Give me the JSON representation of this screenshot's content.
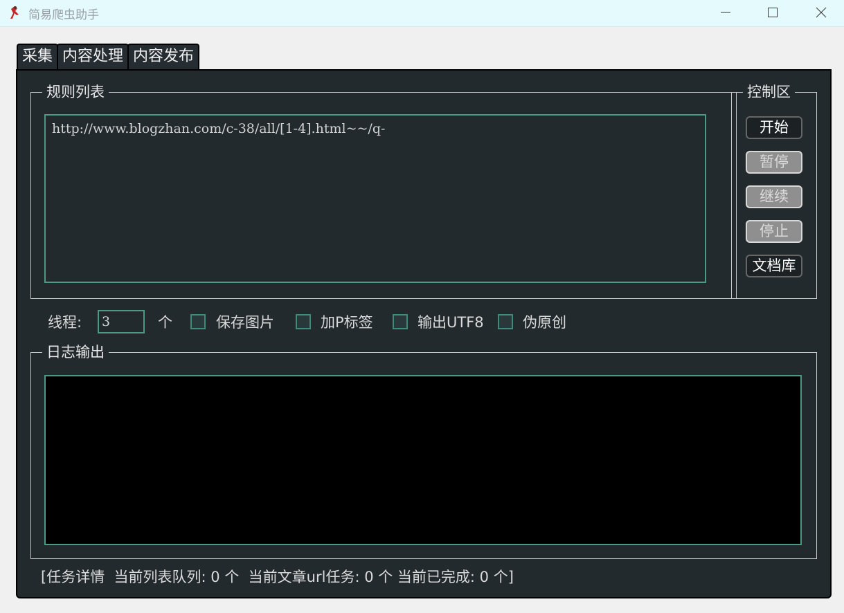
{
  "window": {
    "title": "简易爬虫助手"
  },
  "tabs": [
    "采集",
    "内容处理",
    "内容发布"
  ],
  "rules": {
    "legend": "规则列表",
    "content": "http://www.blogzhan.com/c-38/all/[1-4].html~~/q-"
  },
  "control": {
    "legend": "控制区",
    "buttons": [
      {
        "label": "开始",
        "enabled": true
      },
      {
        "label": "暂停",
        "enabled": false
      },
      {
        "label": "继续",
        "enabled": false
      },
      {
        "label": "停止",
        "enabled": false
      },
      {
        "label": "文档库",
        "enabled": true
      }
    ]
  },
  "options": {
    "threads_label": "线程:",
    "threads_value": "3",
    "threads_unit": "个",
    "save_images": "保存图片",
    "add_p_tag": "加P标签",
    "output_utf8": "输出UTF8",
    "pseudo_original": "伪原创"
  },
  "log": {
    "legend": "日志输出"
  },
  "status": {
    "text": "[任务详情  当前列表队列: 0 个  当前文章url任务: 0 个 当前已完成: 0 个]"
  },
  "colors": {
    "panel": "#232a2e",
    "accent": "#4a9a86",
    "titlebar": "#e4fafd"
  }
}
